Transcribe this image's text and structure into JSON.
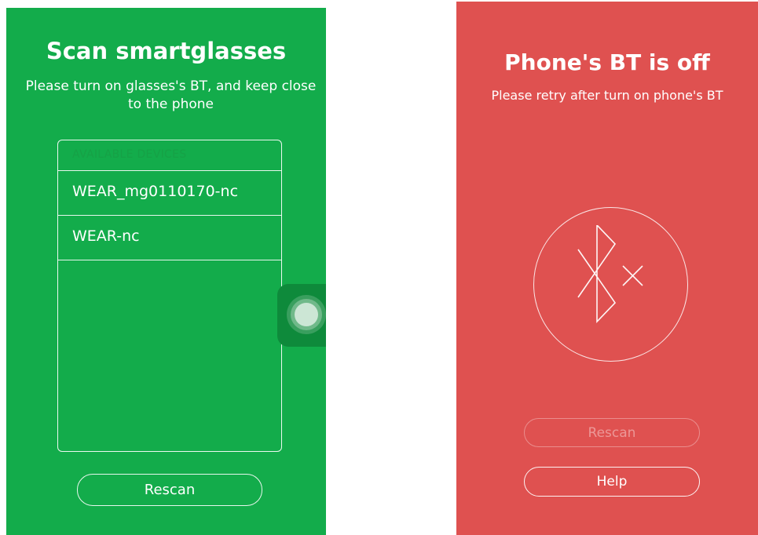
{
  "scan_screen": {
    "title": "Scan smartglasses",
    "subtitle_line1": "Please turn on glasses's BT, and keep close",
    "subtitle_line2": "to the phone",
    "list_header": "AVAILABLE DEVICES",
    "devices": [
      {
        "label": "WEAR_mg0110170-nc"
      },
      {
        "label": "WEAR-nc"
      }
    ],
    "rescan_label": "Rescan",
    "background_color": "#13ac4b"
  },
  "bt_off_screen": {
    "title": "Phone's BT is off",
    "subtitle": "Please retry after turn on phone's BT",
    "icon": "bluetooth-off-icon",
    "rescan_label": "Rescan",
    "help_label": "Help",
    "background_color": "#df5150"
  },
  "overlay": {
    "icon": "assistive-touch-icon"
  }
}
